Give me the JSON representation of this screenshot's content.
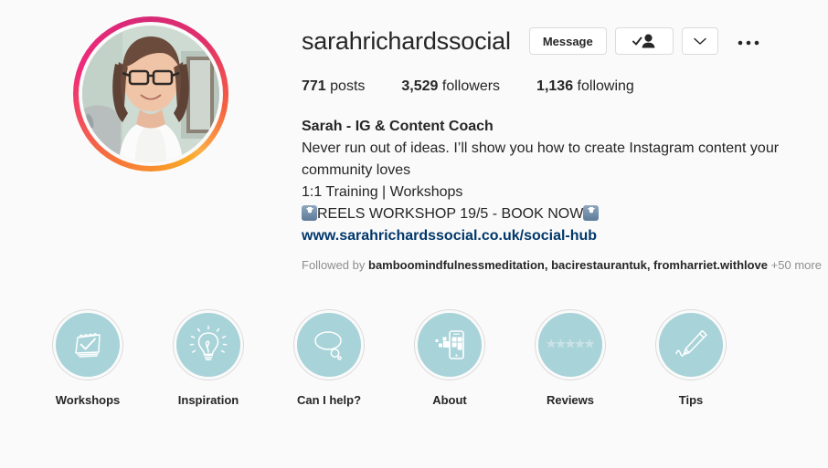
{
  "profile": {
    "username": "sarahrichardssocial",
    "avatar_alt": "profile-photo",
    "story_ring": true,
    "ring_colors": [
      "#f9a825",
      "#f77737",
      "#ee2a7b",
      "#d62976",
      "#e1306c",
      "#f56040",
      "#fcaf45"
    ]
  },
  "actions": {
    "message_label": "Message",
    "following_icon": "person-check-icon",
    "dropdown_icon": "chevron-down-icon",
    "more_icon": "ellipsis-icon"
  },
  "stats": [
    {
      "number": "771",
      "label": "posts"
    },
    {
      "number": "3,529",
      "label": "followers"
    },
    {
      "number": "1,136",
      "label": "following"
    }
  ],
  "bio": {
    "name": "Sarah - IG & Content Coach",
    "line1": "Never run out of ideas. I’ll show you how to create Instagram content your community loves",
    "line2": "1:1 Training | Workshops",
    "line3_text": "REELS WORKSHOP 19/5 - BOOK NOW",
    "link": "www.sarahrichardssocial.co.uk/social-hub",
    "link_color": "#00376b"
  },
  "followed_by": {
    "prefix": "Followed by",
    "names": "bamboomindfulnessmeditation, bacirestaurantuk, fromharriet.withlove",
    "more": "+50 more"
  },
  "highlights": {
    "circle_color": "#a8d3d9",
    "items": [
      {
        "label": "Workshops",
        "icon": "calendar-check-icon"
      },
      {
        "label": "Inspiration",
        "icon": "lightbulb-icon"
      },
      {
        "label": "Can I help?",
        "icon": "thought-bubble-icon"
      },
      {
        "label": "About",
        "icon": "phone-tiles-icon"
      },
      {
        "label": "Reviews",
        "icon": "five-stars-icon"
      },
      {
        "label": "Tips",
        "icon": "pencil-squiggle-icon"
      }
    ]
  }
}
